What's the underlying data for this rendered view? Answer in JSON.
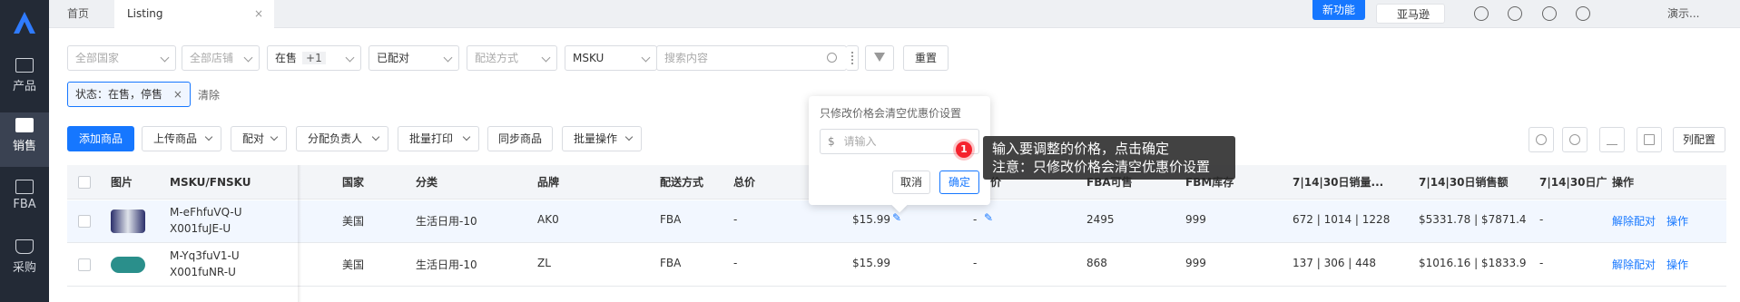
{
  "nav": {
    "items": [
      {
        "label": "产品",
        "icon": "bag-icon"
      },
      {
        "label": "销售",
        "icon": "sell-icon"
      },
      {
        "label": "FBA",
        "icon": "box-icon"
      },
      {
        "label": "采购",
        "icon": "cart-icon"
      }
    ]
  },
  "tabs": [
    {
      "label": "首页"
    },
    {
      "label": "Listing",
      "close": "×"
    }
  ],
  "top": {
    "new_feature": "新功能",
    "marketplace": "亚马逊",
    "user": "演示..."
  },
  "filters": {
    "country": "全部国家",
    "shop": "全部店铺",
    "status": "在售",
    "status_more": "+1",
    "match": "已配对",
    "shipping": "配送方式",
    "sku_type": "MSKU",
    "search_placeholder": "搜索内容",
    "reset": "重置"
  },
  "active_tag": {
    "label": "状态：在售，停售",
    "close": "×"
  },
  "clear": "清除",
  "actions": {
    "add": "添加商品",
    "upload": "上传商品",
    "pair": "配对",
    "assign": "分配负责人",
    "print": "批量打印",
    "sync": "同步商品",
    "batch": "批量操作",
    "columns": "列配置"
  },
  "table": {
    "headers": {
      "image": "图片",
      "msku": "MSKU/FNSKU",
      "country": "国家",
      "category": "分类",
      "brand": "品牌",
      "shipping": "配送方式",
      "total_price": "总价",
      "price": "价",
      "fba_available": "FBA可售",
      "fbm_stock": "FBM库存",
      "sales_qty": "7|14|30日销量...",
      "sales_amount": "7|14|30日销售额",
      "sales_30": "7|14|30日广",
      "ops": "操作"
    },
    "rows": [
      {
        "msku": "M-eFhfuVQ-U",
        "fnsku": "X001fuJE-U",
        "country": "美国",
        "category": "生活日用-10",
        "brand": "AK0",
        "shipping": "FBA",
        "total_price": "-",
        "price": "$15.99",
        "sale_price": "-",
        "fba": "2495",
        "fbm": "999",
        "qty": "672 | 1014 | 1228",
        "amount": "$5331.78 | $7871.4",
        "ads": "-",
        "unpair": "解除配对",
        "op": "操作"
      },
      {
        "msku": "M-Yq3fuV1-U",
        "fnsku": "X001fuNR-U",
        "country": "美国",
        "category": "生活日用-10",
        "brand": "ZL",
        "shipping": "FBA",
        "total_price": "-",
        "price": "$15.99",
        "sale_price": "-",
        "fba": "868",
        "fbm": "999",
        "qty": "137 | 306 | 448",
        "amount": "$1016.16 | $1833.9",
        "ads": "-",
        "unpair": "解除配对",
        "op": "操作"
      }
    ]
  },
  "popover": {
    "title": "只修改价格会清空优惠价设置",
    "currency": "$",
    "placeholder": "请输入",
    "cancel": "取消",
    "confirm": "确定"
  },
  "tip": {
    "step": "1",
    "line1": "输入要调整的价格，点击确定",
    "line2": "注意：只修改价格会清空优惠价设置"
  },
  "colors": {
    "accent": "#1677ff",
    "nav_bg": "#232a36",
    "danger": "#f5222d"
  }
}
